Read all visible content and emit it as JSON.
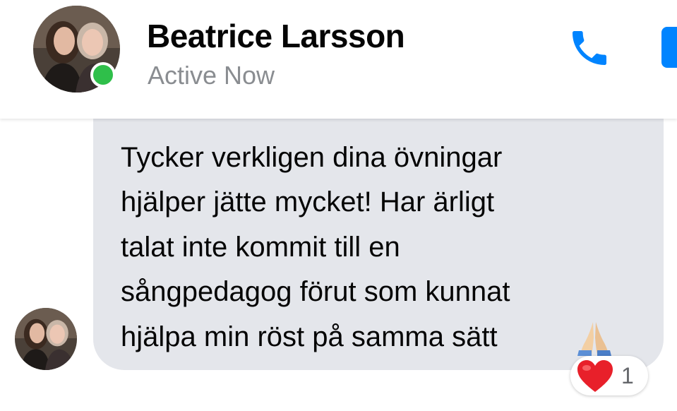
{
  "header": {
    "contact_name": "Beatrice Larsson",
    "status": "Active Now",
    "presence_color": "#2fbf4a",
    "actions": [
      {
        "icon": "phone-icon",
        "color": "#0084ff"
      },
      {
        "icon": "video-camera-icon",
        "color": "#0084ff"
      }
    ]
  },
  "message": {
    "text": "Tycker verkligen dina övningar\nhjälper jätte mycket! Har ärligt\ntalat inte kommit till en\nsångpedagog förut som kunnat\nhjälpa min röst på samma sätt",
    "emoji": "folded-hands-emoji",
    "bubble_color": "#e4e6eb"
  },
  "reaction": {
    "icon": "red-heart-emoji",
    "count": "1"
  }
}
